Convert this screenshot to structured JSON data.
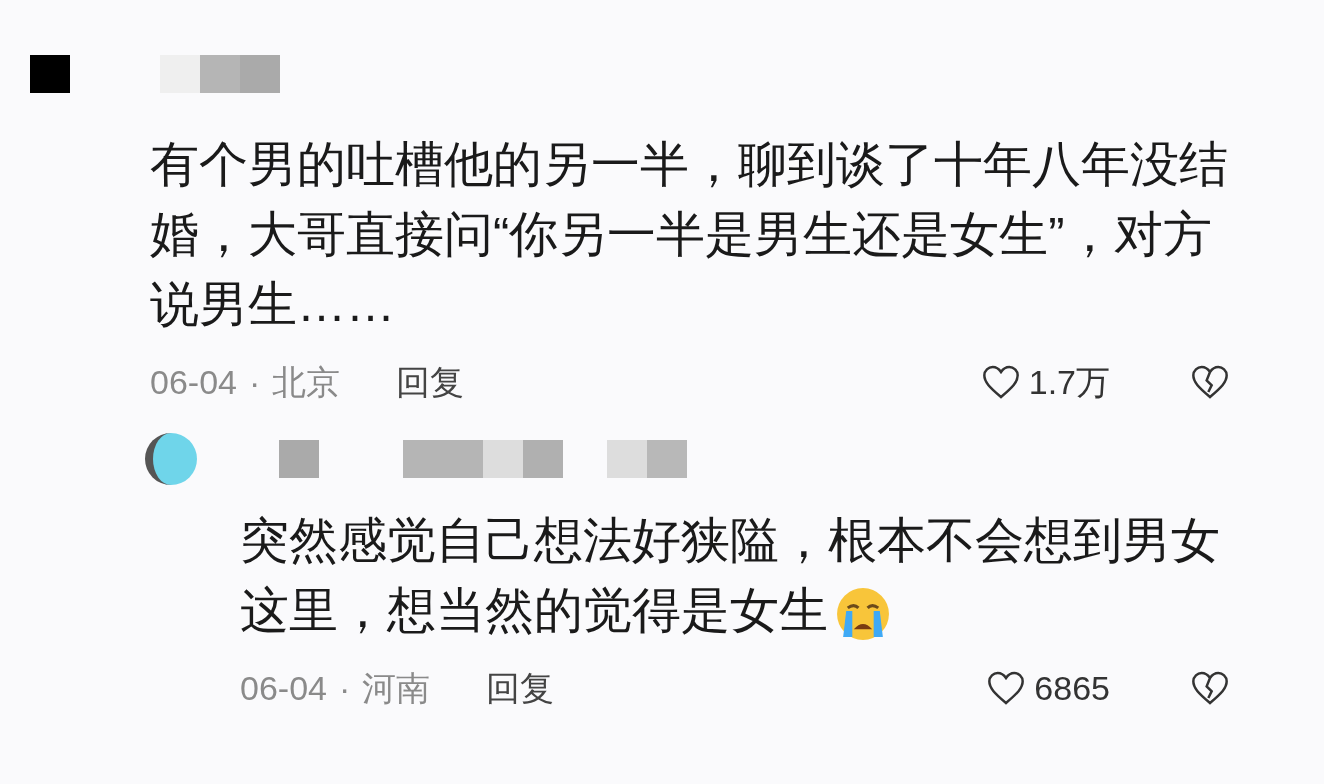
{
  "comments": [
    {
      "kind": "comment",
      "text_lines": [
        "有个男的吐槽他的另一半，聊到谈了十年八年没结",
        "婚，大哥直接问“你另一半是男生还是女生”，对方",
        "说男生……"
      ],
      "emoji": false,
      "date": "06-04",
      "separator": "·",
      "location": "北京",
      "reply": "回复",
      "likes": "1.7万"
    },
    {
      "kind": "reply",
      "text_lines": [
        "突然感觉自己想法好狭隘，根本不会想到男女",
        "这里，想当然的觉得是女生"
      ],
      "emoji": true,
      "date": "06-04",
      "separator": "·",
      "location": "河南",
      "reply": "回复",
      "likes": "6865"
    }
  ]
}
